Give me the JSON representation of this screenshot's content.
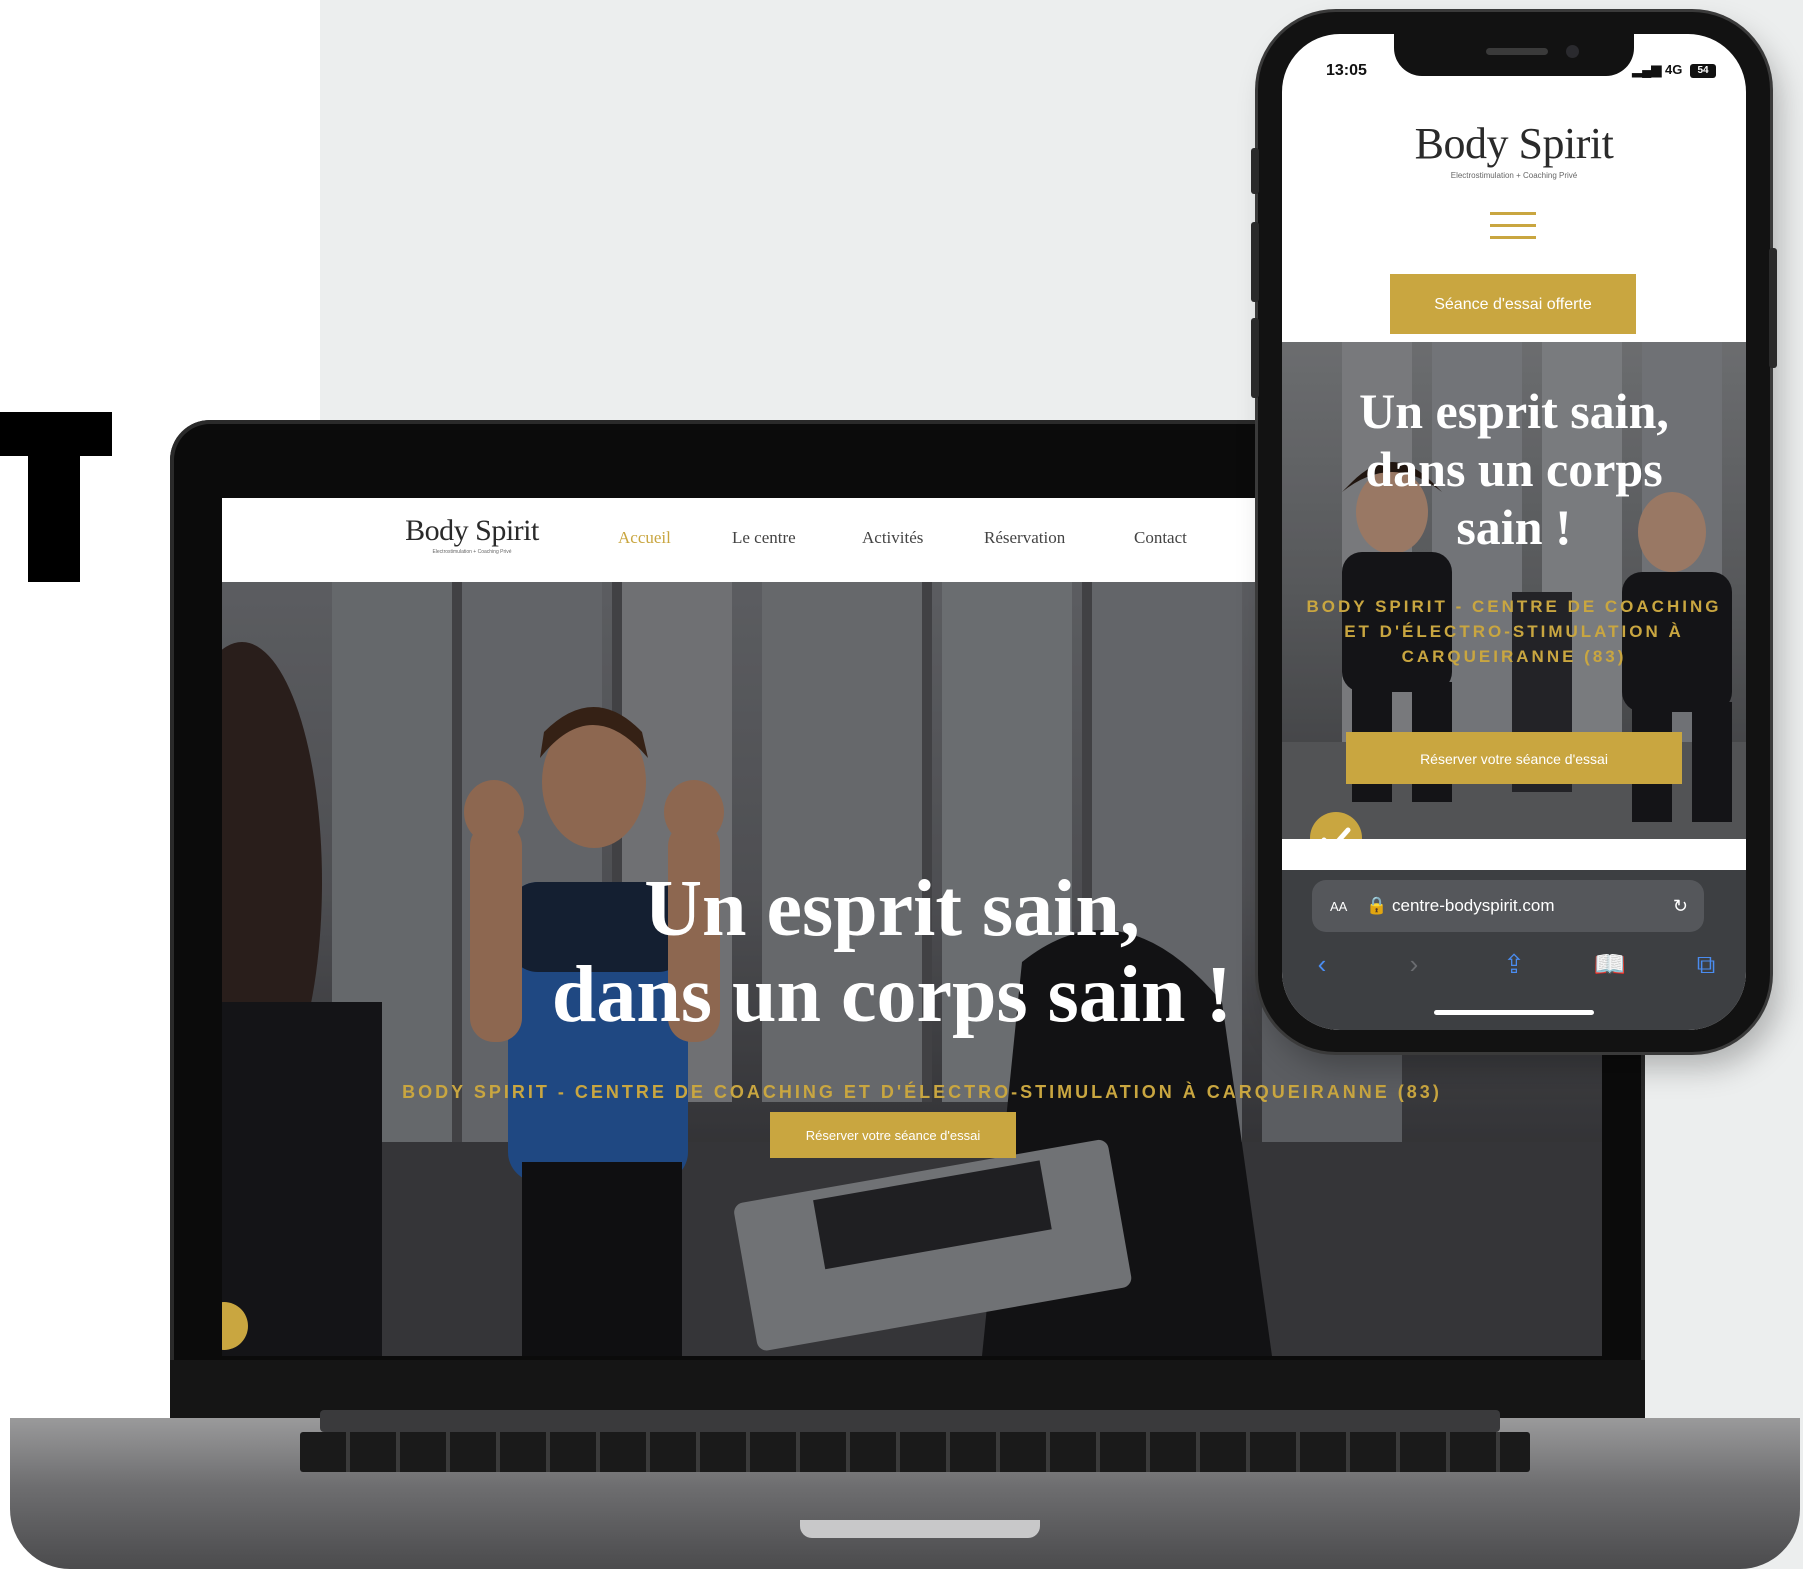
{
  "brand": {
    "name": "Body Spirit",
    "tagline": "Electrostimulation + Coaching Privé",
    "accent": "#c9a640"
  },
  "desktop": {
    "nav": [
      {
        "label": "Accueil",
        "active": true
      },
      {
        "label": "Le centre",
        "active": false
      },
      {
        "label": "Activités",
        "active": false
      },
      {
        "label": "Réservation",
        "active": false
      },
      {
        "label": "Contact",
        "active": false
      }
    ],
    "hero": {
      "title_line1": "Un esprit sain,",
      "title_line2": "dans un corps sain !",
      "subtitle": "BODY SPIRIT - CENTRE DE COACHING ET D'ÉLECTRO-STIMULATION À CARQUEIRANNE (83)",
      "cta": "Réserver votre séance d'essai"
    }
  },
  "mobile": {
    "status": {
      "time": "13:05",
      "network": "4G",
      "battery": "54"
    },
    "menu_icon": "hamburger-icon",
    "top_cta": "Séance d'essai offerte",
    "hero": {
      "title_line1": "Un esprit sain,",
      "title_line2": "dans un corps",
      "title_line3": "sain !",
      "subtitle": "BODY SPIRIT - CENTRE DE COACHING ET D'ÉLECTRO-STIMULATION À CARQUEIRANNE (83)",
      "cta": "Réserver votre séance d'essai"
    },
    "browser": {
      "text_size": "AA",
      "url": "centre-bodyspirit.com"
    }
  }
}
